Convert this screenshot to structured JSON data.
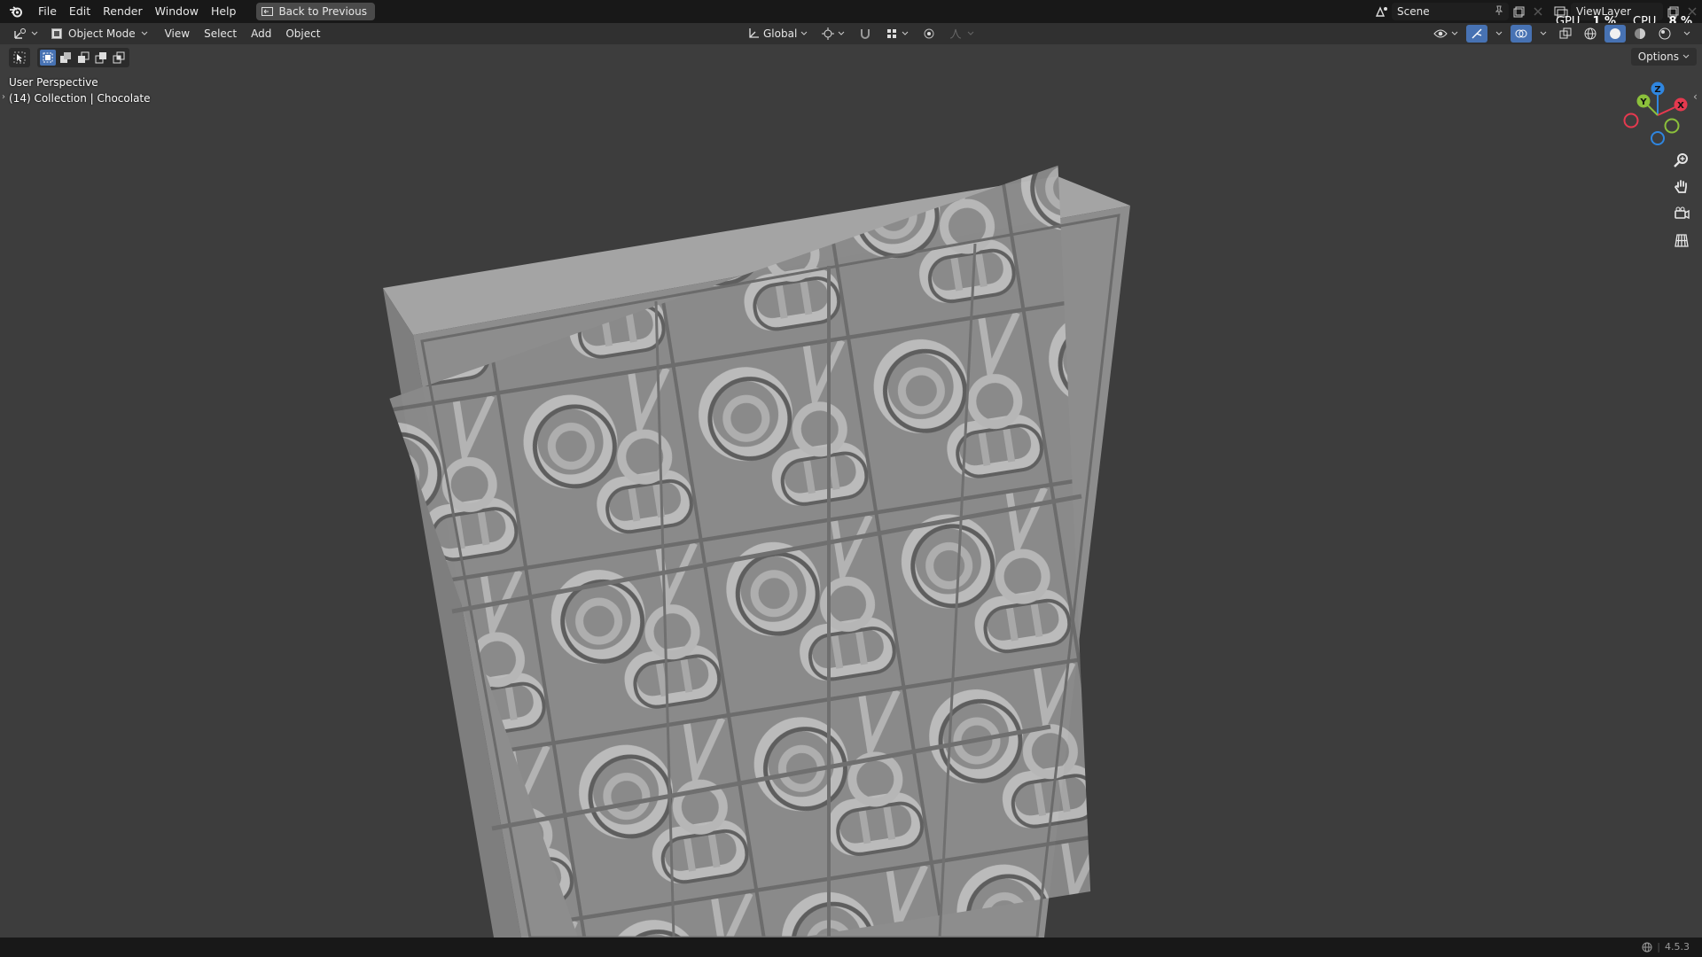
{
  "menu": {
    "items": [
      "File",
      "Edit",
      "Render",
      "Window",
      "Help"
    ],
    "back_button": "Back to Previous"
  },
  "top_right": {
    "scene": "Scene",
    "view_layer": "ViewLayer",
    "gpu_label": "GPU",
    "gpu_value": "1 %",
    "cpu_label": "CPU",
    "cpu_value": "8 %"
  },
  "header": {
    "mode": "Object Mode",
    "menus": [
      "View",
      "Select",
      "Add",
      "Object"
    ],
    "transform_orientation": "Global",
    "options": "Options"
  },
  "viewport": {
    "perspective": "User Perspective",
    "collection": "(14) Collection | Chocolate"
  },
  "gizmo": {
    "x": "X",
    "y": "Y",
    "z": "Z",
    "colors": {
      "x": "#e5394f",
      "y": "#8bc03b",
      "z": "#2f86e0"
    }
  },
  "status": {
    "version": "4.5.3"
  }
}
